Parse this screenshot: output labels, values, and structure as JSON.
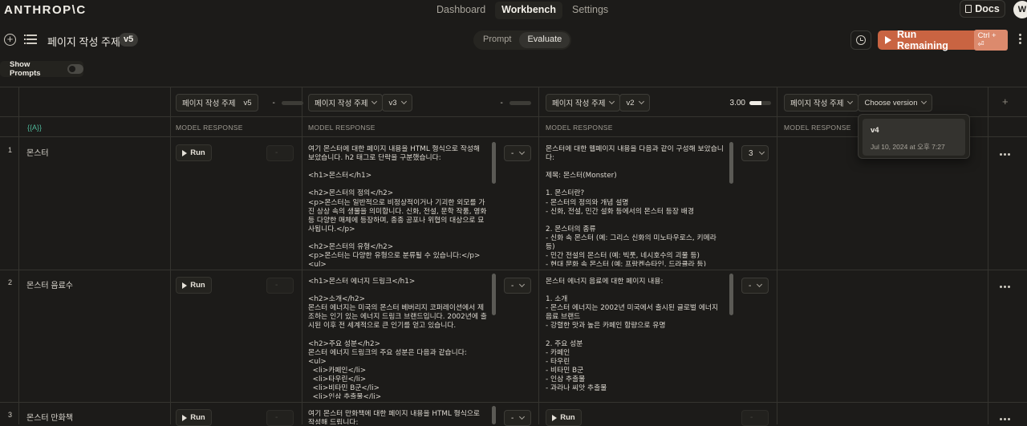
{
  "brand": "ANTHROP\\C",
  "nav": {
    "tabs": [
      "Dashboard",
      "Workbench",
      "Settings"
    ],
    "active": "Workbench"
  },
  "docs_label": "Docs",
  "avatar_initial": "W",
  "prompt": {
    "title": "페이지 작성 주제",
    "version": "v5"
  },
  "mode": {
    "prompt": "Prompt",
    "evaluate": "Evaluate"
  },
  "run_remaining": {
    "label": "Run Remaining",
    "shortcut": "Ctrl + ⏎"
  },
  "show_prompts": {
    "label": "Show Prompts",
    "on": false
  },
  "columns": [
    {
      "name": "페이지 작성 주제",
      "version": "v5",
      "score": "-"
    },
    {
      "name": "페이지 작성 주제",
      "version": "v3",
      "score": "-"
    },
    {
      "name": "페이지 작성 주제",
      "version": "v2",
      "score": "3.00"
    },
    {
      "name": "페이지 작성 주제",
      "version": "Choose version"
    }
  ],
  "variable_label": "{{A}}",
  "model_response_label": "MODEL RESPONSE",
  "run_label": "Run",
  "rows": [
    {
      "num": "1",
      "name": "몬스터",
      "resp_v3": "여기 몬스터에 대한 페이지 내용을 HTML 형식으로 작성해 보았습니다. h2 태그로 단락을 구분했습니다:\n\n<h1>몬스터</h1>\n\n<h2>몬스터의 정의</h2>\n<p>몬스터는 일반적으로 비정상적이거나 기괴한 외모를 가진 상상 속의 생물을 의미합니다. 신화, 전설, 문학 작품, 영화 등 다양한 매체에 등장하며, 종종 공포나 위협의 대상으로 묘사됩니다.</p>\n\n<h2>몬스터의 유형</h2>\n<p>몬스터는 다양한 유형으로 분류될 수 있습니다:</p>\n<ul>",
      "score_v3": "-",
      "resp_v2": "몬스터에 대한 웹페이지 내용을 다음과 같이 구성해 보았습니다:\n\n제목: 몬스터(Monster)\n\n1. 몬스터란?\n- 몬스터의 정의와 개념 설명\n- 신화, 전설, 민간 설화 등에서의 몬스터 등장 배경\n\n2. 몬스터의 종류\n- 신화 속 몬스터 (예: 그리스 신화의 미노타우로스, 키메라 등)\n- 민간 전설의 몬스터 (예: 빅풋, 네시호수의 괴물 등)\n- 현대 문화 속 몬스터 (예: 프랑켄슈타인, 드라큘라 등)",
      "score_v2": "3"
    },
    {
      "num": "2",
      "name": "몬스터 음료수",
      "resp_v3": "<h1>몬스터 에너지 드링크</h1>\n\n<h2>소개</h2>\n몬스터 에너지는 미국의 몬스터 베버리지 코퍼레이션에서 제조하는 인기 있는 에너지 드링크 브랜드입니다. 2002년에 출시된 이후 전 세계적으로 큰 인기를 얻고 있습니다.\n\n<h2>주요 성분</h2>\n몬스터 에너지 드링크의 주요 성분은 다음과 같습니다:\n<ul>\n  <li>카페인</li>\n  <li>타우린</li>\n  <li>비타민 B군</li>\n  <li>인삼 추출물</li>",
      "score_v3": "-",
      "resp_v2": "몬스터 에너지 음료에 대한 페이지 내용:\n\n1. 소개\n- 몬스터 에너지는 2002년 미국에서 출시된 글로벌 에너지 음료 브랜드\n- 강렬한 맛과 높은 카페인 함량으로 유명\n\n2. 주요 성분\n- 카페인\n- 타우린\n- 비타민 B군\n- 인삼 추출물\n- 과라나 씨앗 추출물",
      "score_v2": "-"
    },
    {
      "num": "3",
      "name": "몬스터 만화책",
      "resp_v3": "여기 몬스터 만화책에 대한 페이지 내용을 HTML 형식으로 작성해 드립니다:",
      "score_v3": "-",
      "score_v2": "-"
    }
  ],
  "version_dropdown": {
    "version": "v4",
    "date": "Jul 10, 2024 at 오후 7:27"
  }
}
